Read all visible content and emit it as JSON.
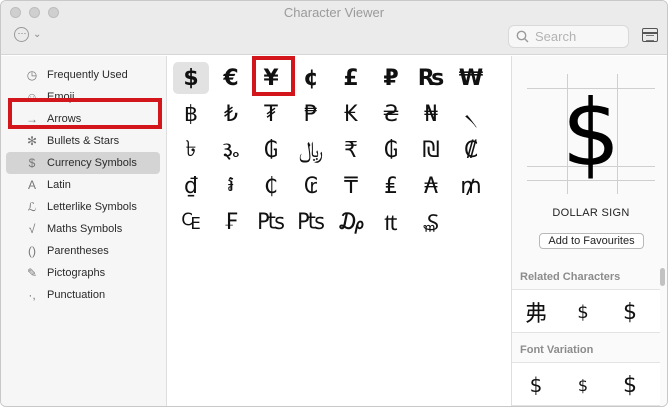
{
  "window": {
    "title": "Character Viewer"
  },
  "toolbar": {
    "action_icon": "ellipsis-circle-icon",
    "action_glyph": "⋯",
    "chevron": "⌄",
    "search_placeholder": "Search"
  },
  "sidebar": {
    "items": [
      {
        "label": "Frequently Used",
        "icon": "clock-icon",
        "glyph": "◷"
      },
      {
        "label": "Emoji",
        "icon": "smiley-icon",
        "glyph": "☺"
      },
      {
        "label": "Arrows",
        "icon": "arrow-icon",
        "glyph": "→"
      },
      {
        "label": "Bullets & Stars",
        "icon": "asterisk-icon",
        "glyph": "✻"
      },
      {
        "label": "Currency Symbols",
        "icon": "dollar-icon",
        "glyph": "$"
      },
      {
        "label": "Latin",
        "icon": "latin-a-icon",
        "glyph": "A"
      },
      {
        "label": "Letterlike Symbols",
        "icon": "letterlike-icon",
        "glyph": "ℒ"
      },
      {
        "label": "Maths Symbols",
        "icon": "sqrt-icon",
        "glyph": "√"
      },
      {
        "label": "Parentheses",
        "icon": "parentheses-icon",
        "glyph": "()"
      },
      {
        "label": "Pictographs",
        "icon": "pencil-icon",
        "glyph": "✎"
      },
      {
        "label": "Punctuation",
        "icon": "punctuation-icon",
        "glyph": "·,"
      }
    ],
    "selected": "Currency Symbols"
  },
  "grid": {
    "rows": [
      [
        "$",
        "€",
        "¥",
        "¢",
        "£",
        "₽",
        "₨",
        "₩"
      ],
      [
        "฿",
        "₺",
        "₮",
        "₱",
        "₭",
        "₴",
        "₦",
        "৲"
      ],
      [
        "৳",
        "૱",
        "₲",
        "﷼",
        "₹",
        "₲",
        "₪",
        "₡"
      ],
      [
        "₫",
        "៛",
        "₵",
        "₢",
        "₸",
        "₤",
        "₳",
        "₥"
      ],
      [
        "₠",
        "₣",
        "₧",
        "₧",
        "₯",
        "₶",
        "₷"
      ]
    ],
    "selected": "$",
    "annotated": "¥"
  },
  "info": {
    "glyph": "$",
    "name": "DOLLAR SIGN",
    "fav_button": "Add to Favourites",
    "related_heading": "Related Characters",
    "related": [
      "弗",
      "$",
      "$"
    ],
    "variation_heading": "Font Variation",
    "variations": [
      "$",
      "$",
      "$"
    ]
  },
  "accent": {
    "annotation": "#d3161c",
    "selected_bg": "#d4d4d4"
  }
}
